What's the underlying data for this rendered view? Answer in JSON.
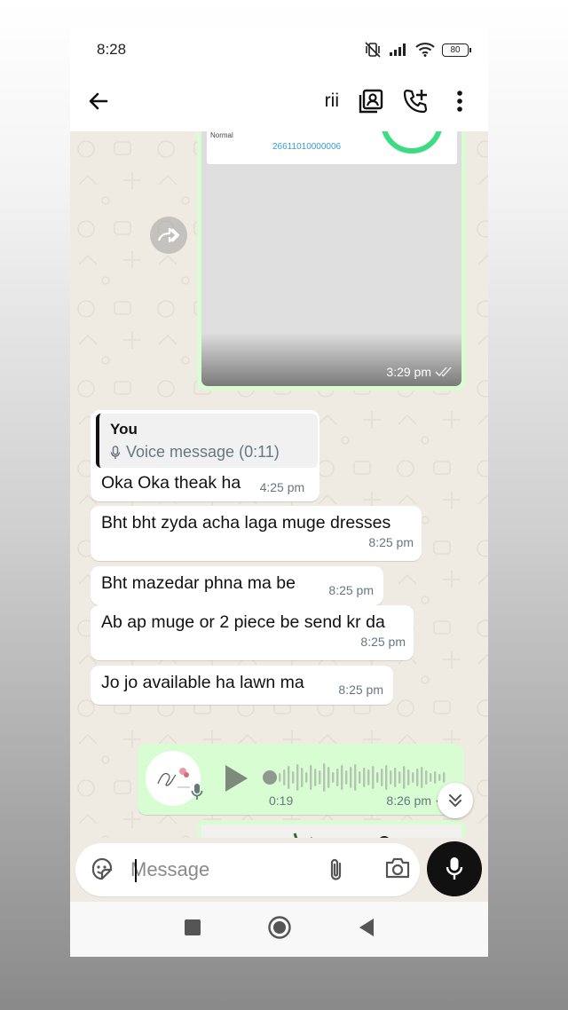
{
  "status_bar": {
    "time": "8:28",
    "battery": "80"
  },
  "app_bar": {
    "title": "rii"
  },
  "messages": {
    "image_card": {
      "label": "Normal",
      "number": "26611010000006"
    },
    "image_time": "3:29 pm",
    "quoted": {
      "author": "You",
      "text": "Voice message (0:11)"
    },
    "incoming": [
      {
        "text": "Oka Oka theak ha",
        "time": "4:25 pm"
      },
      {
        "text": "Bht bht zyda acha laga muge dresses",
        "time": "8:25 pm"
      },
      {
        "text": "Bht mazedar phna ma be",
        "time": "8:25 pm"
      },
      {
        "text": "Ab ap muge or 2 piece be send kr da",
        "time": "8:25 pm"
      },
      {
        "text": "Jo jo available ha lawn ma",
        "time": "8:25 pm"
      }
    ],
    "voice_note": {
      "duration": "0:19",
      "time": "8:26 pm"
    }
  },
  "composer": {
    "placeholder": "Message"
  },
  "colors": {
    "outgoing_bubble": "#d9fdd3",
    "incoming_bubble": "#ffffff",
    "chat_bg": "#efeae2",
    "tick": "#667781"
  },
  "icons": [
    "back-arrow-icon",
    "contact-card-icon",
    "add-call-icon",
    "more-vert-icon",
    "forward-icon",
    "mic-icon",
    "play-icon",
    "double-tick-icon",
    "chevron-double-down-icon",
    "sticker-icon",
    "attach-icon",
    "camera-icon",
    "square-nav-icon",
    "home-nav-icon",
    "back-nav-icon"
  ]
}
